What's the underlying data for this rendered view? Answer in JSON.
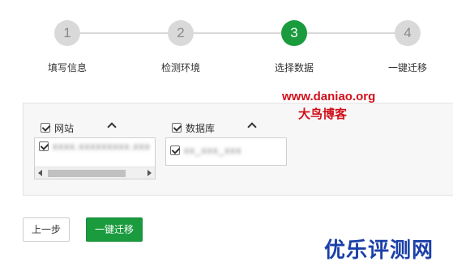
{
  "stepper": {
    "steps": [
      {
        "number": "1",
        "label": "填写信息",
        "state": "done"
      },
      {
        "number": "2",
        "label": "检测环境",
        "state": "done"
      },
      {
        "number": "3",
        "label": "选择数据",
        "state": "active"
      },
      {
        "number": "4",
        "label": "一键迁移",
        "state": "pending"
      }
    ],
    "active_color": "#1a9b3e",
    "inactive_color": "#d9d9d9"
  },
  "watermark": {
    "url": "www.daniao.org",
    "blog": "大鸟博客",
    "brand": "优乐评测网"
  },
  "selection": {
    "sites": {
      "label": "网站",
      "checked": true,
      "items": [
        {
          "text": "xxxx.xxxxxxxxx.xxx",
          "checked": true,
          "obscured": true
        }
      ]
    },
    "databases": {
      "label": "数据库",
      "checked": true,
      "items": [
        {
          "text": "xx_xxx_xxx",
          "checked": true,
          "obscured": true
        }
      ]
    }
  },
  "actions": {
    "prev_label": "上一步",
    "next_label": "一键迁移",
    "primary_color": "#1a9b3e"
  }
}
